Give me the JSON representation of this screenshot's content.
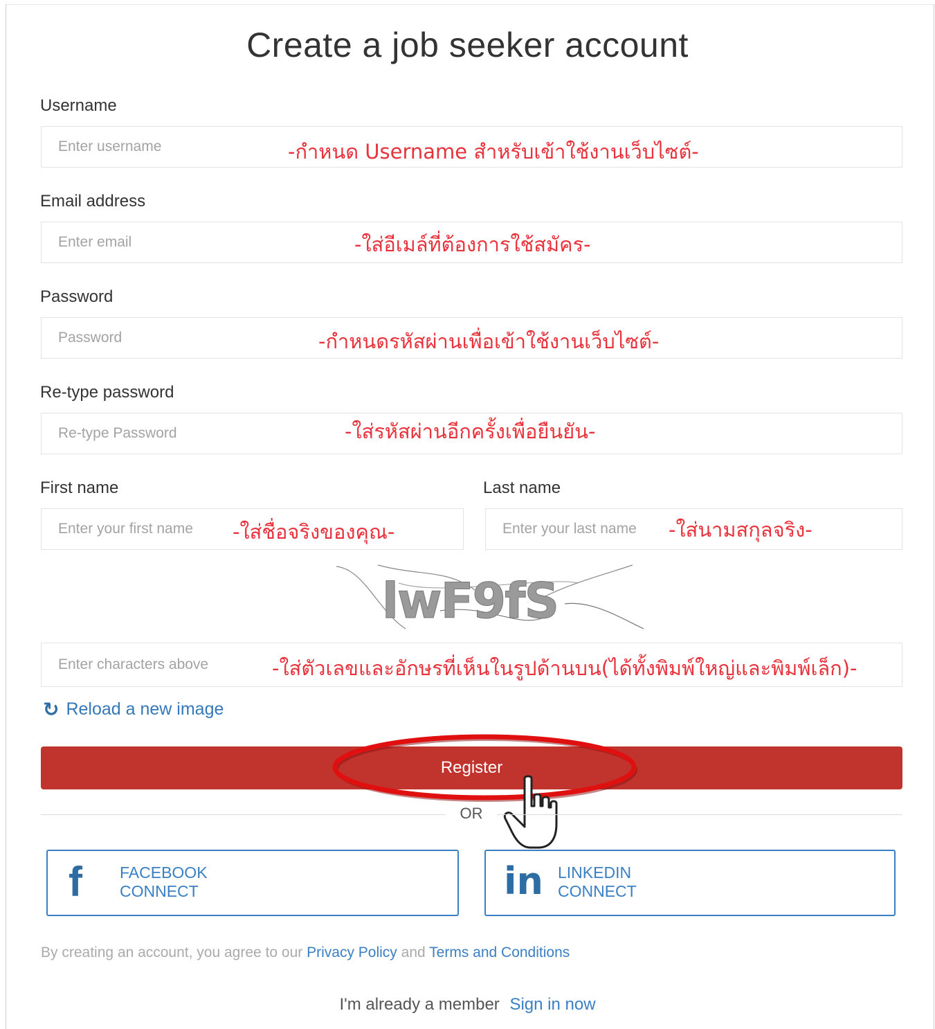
{
  "title": "Create a job seeker account",
  "username": {
    "label": "Username",
    "placeholder": "Enter username",
    "note": "-กำหนด Username สำหรับเข้าใช้งานเว็บไซต์-"
  },
  "email": {
    "label": "Email address",
    "placeholder": "Enter email",
    "note": "-ใส่อีเมล์ที่ต้องการใช้สมัคร-"
  },
  "password": {
    "label": "Password",
    "placeholder": "Password",
    "note": "-กำหนดรหัสผ่านเพื่อเข้าใช้งานเว็บไซต์-"
  },
  "retype": {
    "label": "Re-type password",
    "placeholder": "Re-type Password",
    "note": "-ใส่รหัสผ่านอีกครั้งเพื่อยืนยัน-"
  },
  "first_name": {
    "label": "First name",
    "placeholder": "Enter your first name",
    "note": "-ใส่ชื่อจริงของคุณ-"
  },
  "last_name": {
    "label": "Last name",
    "placeholder": "Enter your last name",
    "note": "-ใส่นามสกุลจริง-"
  },
  "captcha": {
    "text": "lwF9fS",
    "placeholder": "Enter characters above",
    "note": "-ใส่ตัวเลขและอักษรที่เห็นในรูปด้านบน(ได้ทั้งพิมพ์ใหญ่และพิมพ์เล็ก)-",
    "reload_label": "Reload a new image",
    "reload_icon": "refresh-icon"
  },
  "register_label": "Register",
  "or_label": "OR",
  "facebook": {
    "line1": "FACEBOOK",
    "line2": "CONNECT",
    "icon": "facebook-icon"
  },
  "linkedin": {
    "line1": "LINKEDIN",
    "line2": "CONNECT",
    "icon": "linkedin-icon"
  },
  "terms": {
    "prefix": "By creating an account, you agree to our",
    "privacy": "Privacy Policy",
    "and": "and",
    "conditions": "Terms and Conditions"
  },
  "member": {
    "text": "I'm already a member",
    "link": "Sign in now"
  },
  "colors": {
    "register_bg": "#c0342d",
    "annotation": "#e8323c",
    "link": "#3a7fc3",
    "highlight_ellipse": "#e01010"
  }
}
